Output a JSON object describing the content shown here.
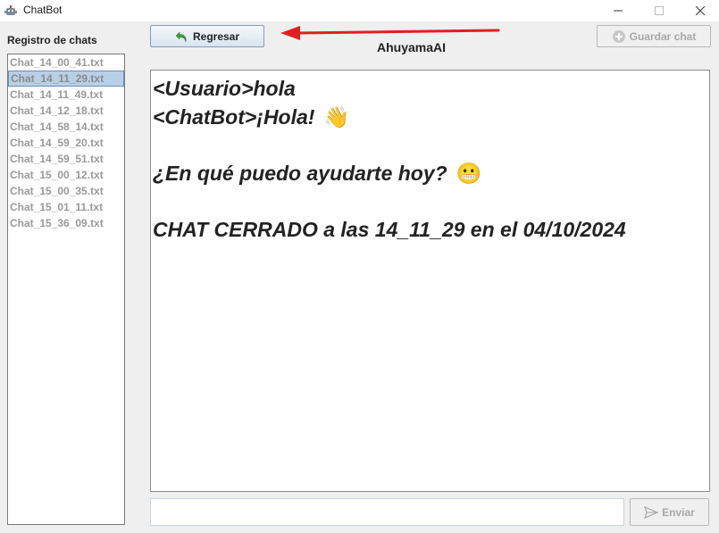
{
  "window": {
    "title": "ChatBot",
    "controls": [
      "minimize",
      "maximize",
      "close"
    ]
  },
  "sidebar": {
    "label": "Registro de chats",
    "selected_index": 1,
    "items": [
      "Chat_14_00_41.txt",
      "Chat_14_11_29.txt",
      "Chat_14_11_49.txt",
      "Chat_14_12_18.txt",
      "Chat_14_58_14.txt",
      "Chat_14_59_20.txt",
      "Chat_14_59_51.txt",
      "Chat_15_00_12.txt",
      "Chat_15_00_35.txt",
      "Chat_15_01_11.txt",
      "Chat_15_36_09.txt"
    ]
  },
  "toolbar": {
    "back_label": "Regresar",
    "back_icon": "undo-arrow-icon",
    "save_label": "Guardar chat",
    "save_icon": "save-icon",
    "brand": "AhuyamaAI",
    "annotation_arrow_color": "#e02020"
  },
  "chat": {
    "lines": [
      {
        "text": "<Usuario>hola",
        "emoji": ""
      },
      {
        "text": "<ChatBot>¡Hola!",
        "emoji": "👋"
      },
      {
        "text": "¿En qué puedo ayudarte hoy?",
        "emoji": "😬"
      },
      {
        "text": "CHAT CERRADO a las 14_11_29 en el 04/10/2024",
        "emoji": ""
      }
    ]
  },
  "composer": {
    "input_value": "",
    "send_label": "Enviar",
    "send_icon": "send-icon"
  },
  "colors": {
    "accent_green": "#3c9a3c",
    "selection": "#b8cfe5",
    "disabled_text": "#a8a8a8"
  }
}
